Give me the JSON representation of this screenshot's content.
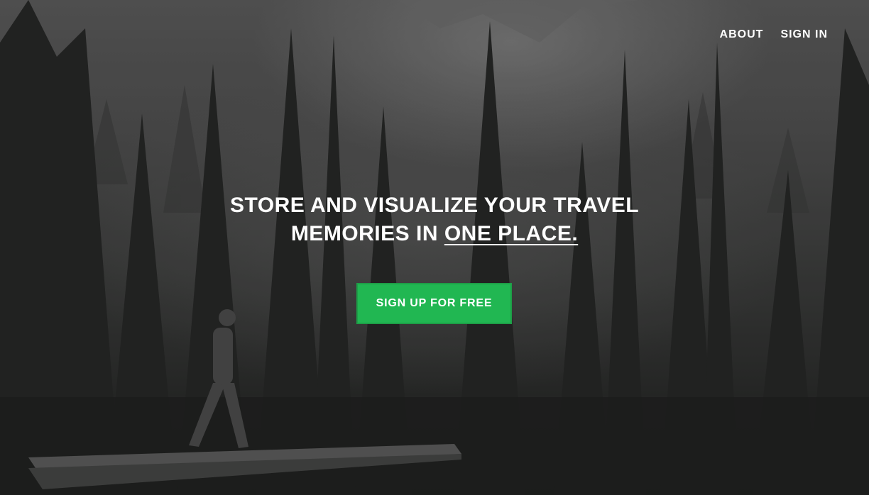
{
  "nav": {
    "about_label": "ABOUT",
    "signin_label": "SIGN IN"
  },
  "hero": {
    "headline_line1": "STORE AND VISUALIZE YOUR TRAVEL",
    "headline_line2_prefix": "MEMORIES IN ",
    "headline_line2_emphasis": "ONE PLACE.",
    "cta_label": "SIGN UP FOR FREE",
    "background_image": "black-and-white photo of a hiker walking on a log boardwalk through a pine forest with mountains behind"
  },
  "colors": {
    "cta_background": "#21b752",
    "cta_border": "#1e9e47",
    "text": "#ffffff"
  }
}
